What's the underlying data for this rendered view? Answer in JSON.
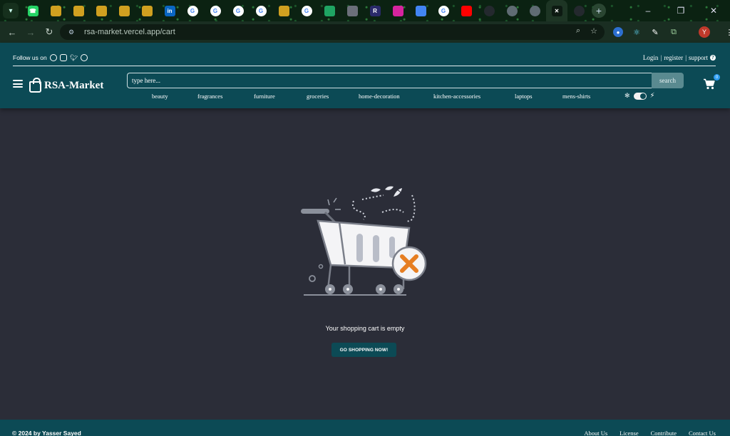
{
  "browser": {
    "tab_icons": [
      "whatsapp-icon",
      "tab-icon",
      "tab-icon",
      "tab-icon",
      "tab-icon",
      "tab-icon",
      "linkedin-icon",
      "google-icon",
      "google-icon",
      "google-icon",
      "google-icon",
      "tab-icon",
      "google-icon",
      "drive-icon",
      "openai-icon",
      "r-icon",
      "instagram-icon",
      "translate-icon",
      "google-icon",
      "youtube-icon",
      "github-icon",
      "globe-icon",
      "globe-icon",
      "close-icon",
      "github-icon"
    ],
    "new_tab_label": "+",
    "minimize_label": "–",
    "restore_label": "❐",
    "close_label": "✕",
    "url": "rsa-market.vercel.app/cart",
    "profile_initial": "Y"
  },
  "header": {
    "follow_label": "Follow us on",
    "brand": "RSA-Market",
    "login": "Login",
    "register": "register",
    "support": "support",
    "separator": "|",
    "help_glyph": "?",
    "cart_count": "0"
  },
  "search": {
    "placeholder": "type here...",
    "button_label": "search"
  },
  "categories": [
    "beauty",
    "fragrances",
    "furniture",
    "groceries",
    "home-decoration",
    "kitchen-accessories",
    "laptops",
    "mens-shirts"
  ],
  "main": {
    "empty_message": "Your shopping cart is empty",
    "cta_label": "GO SHOPPING NOW!"
  },
  "footer": {
    "copyright": "© 2024 by Yasser Sayed",
    "links": [
      "About Us",
      "License",
      "Contribute",
      "Contact Us"
    ]
  },
  "colors": {
    "header_bg": "#0c4a55",
    "page_bg": "#2b2d38",
    "accent_x": "#e67e22",
    "badge": "#2c9cf0"
  }
}
